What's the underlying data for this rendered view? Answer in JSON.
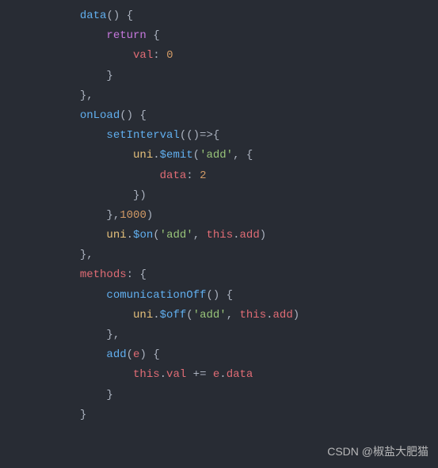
{
  "code": {
    "lines": [
      {
        "indent": 3,
        "tokens": [
          {
            "t": "method-name",
            "v": "data"
          },
          {
            "t": "punct",
            "v": "() {"
          }
        ]
      },
      {
        "indent": 4,
        "tokens": [
          {
            "t": "keyword",
            "v": "return"
          },
          {
            "t": "punct",
            "v": " {"
          }
        ]
      },
      {
        "indent": 5,
        "tokens": [
          {
            "t": "property",
            "v": "val"
          },
          {
            "t": "punct",
            "v": ": "
          },
          {
            "t": "number",
            "v": "0"
          }
        ]
      },
      {
        "indent": 4,
        "tokens": [
          {
            "t": "punct",
            "v": "}"
          }
        ]
      },
      {
        "indent": 3,
        "tokens": [
          {
            "t": "punct",
            "v": "},"
          }
        ]
      },
      {
        "indent": 3,
        "tokens": [
          {
            "t": "method-name",
            "v": "onLoad"
          },
          {
            "t": "punct",
            "v": "() {"
          }
        ]
      },
      {
        "indent": 4,
        "tokens": [
          {
            "t": "method-name",
            "v": "setInterval"
          },
          {
            "t": "punct",
            "v": "(()=>{"
          }
        ]
      },
      {
        "indent": 5,
        "tokens": [
          {
            "t": "builtin",
            "v": "uni"
          },
          {
            "t": "punct",
            "v": "."
          },
          {
            "t": "method-name",
            "v": "$emit"
          },
          {
            "t": "punct",
            "v": "("
          },
          {
            "t": "string",
            "v": "'add'"
          },
          {
            "t": "punct",
            "v": ", {"
          }
        ]
      },
      {
        "indent": 6,
        "tokens": [
          {
            "t": "property",
            "v": "data"
          },
          {
            "t": "punct",
            "v": ": "
          },
          {
            "t": "number",
            "v": "2"
          }
        ]
      },
      {
        "indent": 5,
        "tokens": [
          {
            "t": "punct",
            "v": "})"
          }
        ]
      },
      {
        "indent": 4,
        "tokens": [
          {
            "t": "punct",
            "v": "},"
          },
          {
            "t": "number",
            "v": "1000"
          },
          {
            "t": "punct",
            "v": ")"
          }
        ]
      },
      {
        "indent": 4,
        "tokens": [
          {
            "t": "builtin",
            "v": "uni"
          },
          {
            "t": "punct",
            "v": "."
          },
          {
            "t": "method-name",
            "v": "$on"
          },
          {
            "t": "punct",
            "v": "("
          },
          {
            "t": "string",
            "v": "'add'"
          },
          {
            "t": "punct",
            "v": ", "
          },
          {
            "t": "this-kw",
            "v": "this"
          },
          {
            "t": "punct",
            "v": "."
          },
          {
            "t": "property",
            "v": "add"
          },
          {
            "t": "punct",
            "v": ")"
          }
        ]
      },
      {
        "indent": 3,
        "tokens": [
          {
            "t": "punct",
            "v": "},"
          }
        ]
      },
      {
        "indent": 3,
        "tokens": [
          {
            "t": "property",
            "v": "methods"
          },
          {
            "t": "punct",
            "v": ": {"
          }
        ]
      },
      {
        "indent": 4,
        "tokens": [
          {
            "t": "method-name",
            "v": "comunicationOff"
          },
          {
            "t": "punct",
            "v": "() {"
          }
        ]
      },
      {
        "indent": 5,
        "tokens": [
          {
            "t": "builtin",
            "v": "uni"
          },
          {
            "t": "punct",
            "v": "."
          },
          {
            "t": "method-name",
            "v": "$off"
          },
          {
            "t": "punct",
            "v": "("
          },
          {
            "t": "string",
            "v": "'add'"
          },
          {
            "t": "punct",
            "v": ", "
          },
          {
            "t": "this-kw",
            "v": "this"
          },
          {
            "t": "punct",
            "v": "."
          },
          {
            "t": "property",
            "v": "add"
          },
          {
            "t": "punct",
            "v": ")"
          }
        ]
      },
      {
        "indent": 4,
        "tokens": [
          {
            "t": "punct",
            "v": "},"
          }
        ]
      },
      {
        "indent": 4,
        "tokens": [
          {
            "t": "method-name",
            "v": "add"
          },
          {
            "t": "punct",
            "v": "("
          },
          {
            "t": "property",
            "v": "e"
          },
          {
            "t": "punct",
            "v": ") {"
          }
        ]
      },
      {
        "indent": 5,
        "tokens": [
          {
            "t": "this-kw",
            "v": "this"
          },
          {
            "t": "punct",
            "v": "."
          },
          {
            "t": "property",
            "v": "val"
          },
          {
            "t": "punct",
            "v": " += "
          },
          {
            "t": "property",
            "v": "e"
          },
          {
            "t": "punct",
            "v": "."
          },
          {
            "t": "property",
            "v": "data"
          }
        ]
      },
      {
        "indent": 4,
        "tokens": [
          {
            "t": "punct",
            "v": "}"
          }
        ]
      },
      {
        "indent": 3,
        "tokens": [
          {
            "t": "punct",
            "v": "}"
          }
        ]
      }
    ]
  },
  "watermark": "CSDN @椒盐大肥猫",
  "indent_unit": "    "
}
